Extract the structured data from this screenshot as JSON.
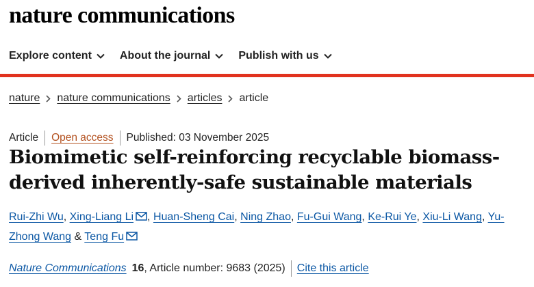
{
  "site": {
    "brand": "nature communications"
  },
  "nav": {
    "items": [
      {
        "label": "Explore content"
      },
      {
        "label": "About the journal"
      },
      {
        "label": "Publish with us"
      }
    ]
  },
  "breadcrumb": {
    "items": [
      "nature",
      "nature communications",
      "articles"
    ],
    "current": "article"
  },
  "article": {
    "type": "Article",
    "access": "Open access",
    "published": "Published: 03 November 2025",
    "title": "Biomimetic self-reinforcing recyclable biomass-derived inherently-safe sustainable materials",
    "authors": [
      "Rui-Zhi Wu",
      "Xing-Liang Li",
      "Huan-Sheng Cai",
      "Ning Zhao",
      "Fu-Gui Wang",
      "Ke-Rui Ye",
      "Xiu-Li Wang",
      "Yu-Zhong Wang",
      "Teng Fu"
    ],
    "author_sep": ",",
    "author_and": "&",
    "journal": "Nature Communications",
    "volume": "16",
    "article_number": ", Article number: 9683 (2025)",
    "cite_label": "Cite this article"
  },
  "colors": {
    "accent_red": "#e1321e",
    "link_blue": "#0b57a4",
    "open_access": "#b3501e"
  },
  "icons": {
    "nav_chevron": "chevron-down-icon",
    "breadcrumb_sep": "chevron-right-icon",
    "contact": "mail-icon"
  }
}
